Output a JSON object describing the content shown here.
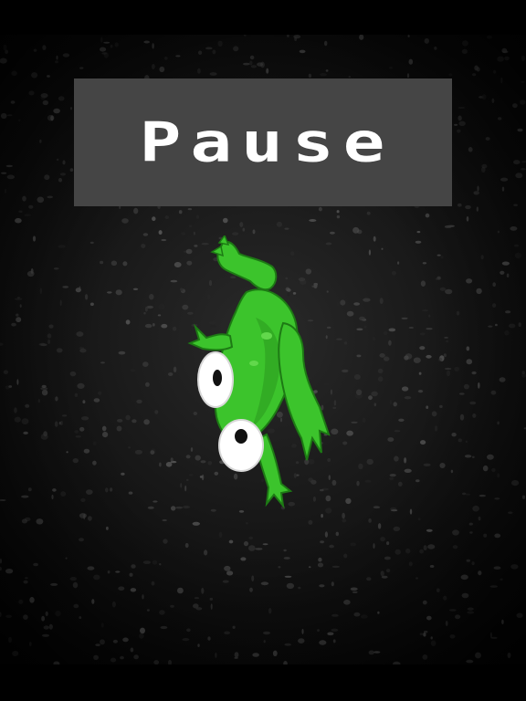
{
  "pause_screen": {
    "title": "Pause"
  },
  "character": {
    "icon": "frog-icon",
    "color": "#3cc42c"
  },
  "colors": {
    "background": "#000000",
    "asphalt": "#161616",
    "banner": "#454545",
    "title_text": "#ffffff"
  }
}
